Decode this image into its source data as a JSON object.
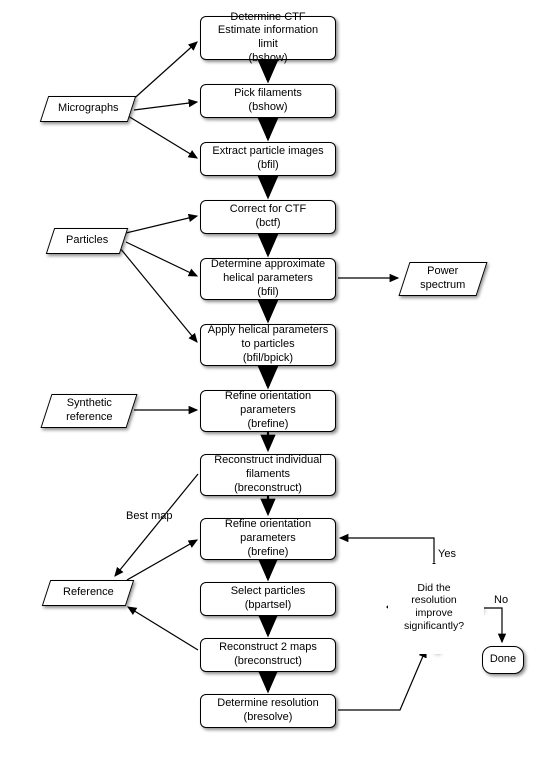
{
  "chart_data": {
    "type": "diagram",
    "title": "",
    "nodes": [
      {
        "id": "n1",
        "type": "process",
        "label": "Determine CTF\nEstimate information limit\n(bshow)"
      },
      {
        "id": "n2",
        "type": "process",
        "label": "Pick filaments\n(bshow)"
      },
      {
        "id": "n3",
        "type": "process",
        "label": "Extract particle images\n(bfil)"
      },
      {
        "id": "n4",
        "type": "process",
        "label": "Correct for CTF\n(bctf)"
      },
      {
        "id": "n5",
        "type": "process",
        "label": "Determine approximate\nhelical parameters\n(bfil)"
      },
      {
        "id": "n6",
        "type": "process",
        "label": "Apply helical parameters\nto particles\n(bfil/bpick)"
      },
      {
        "id": "n7",
        "type": "process",
        "label": "Refine orientation\nparameters\n(brefine)"
      },
      {
        "id": "n8",
        "type": "process",
        "label": "Reconstruct individual\nfilaments\n(breconstruct)"
      },
      {
        "id": "n9",
        "type": "process",
        "label": "Refine orientation\nparameters\n(brefine)"
      },
      {
        "id": "n10",
        "type": "process",
        "label": "Select particles\n(bpartsel)"
      },
      {
        "id": "n11",
        "type": "process",
        "label": "Reconstruct 2 maps\n(breconstruct)"
      },
      {
        "id": "n12",
        "type": "process",
        "label": "Determine resolution\n(bresolve)"
      },
      {
        "id": "io1",
        "type": "io",
        "label": "Micrographs"
      },
      {
        "id": "io2",
        "type": "io",
        "label": "Particles"
      },
      {
        "id": "io3",
        "type": "io",
        "label": "Power\nspectrum"
      },
      {
        "id": "io4",
        "type": "io",
        "label": "Synthetic\nreference"
      },
      {
        "id": "io5",
        "type": "io",
        "label": "Reference"
      },
      {
        "id": "d1",
        "type": "decision",
        "label": "Did the\nresolution\nimprove\nsignificantly?"
      },
      {
        "id": "t1",
        "type": "terminal",
        "label": "Done"
      }
    ],
    "edges": [
      {
        "from": "n1",
        "to": "n2"
      },
      {
        "from": "n2",
        "to": "n3"
      },
      {
        "from": "n3",
        "to": "n4"
      },
      {
        "from": "n4",
        "to": "n5"
      },
      {
        "from": "n5",
        "to": "n6"
      },
      {
        "from": "n6",
        "to": "n7"
      },
      {
        "from": "n7",
        "to": "n8"
      },
      {
        "from": "n8",
        "to": "n9"
      },
      {
        "from": "n9",
        "to": "n10"
      },
      {
        "from": "n10",
        "to": "n11"
      },
      {
        "from": "n11",
        "to": "n12"
      },
      {
        "from": "io1",
        "to": "n1"
      },
      {
        "from": "io1",
        "to": "n2"
      },
      {
        "from": "io1",
        "to": "n3"
      },
      {
        "from": "io2",
        "to": "n4"
      },
      {
        "from": "io2",
        "to": "n5"
      },
      {
        "from": "io2",
        "to": "n6"
      },
      {
        "from": "io4",
        "to": "n7"
      },
      {
        "from": "n5",
        "to": "io3"
      },
      {
        "from": "n8",
        "to": "io5",
        "label": "Best map"
      },
      {
        "from": "io5",
        "to": "n9"
      },
      {
        "from": "n11",
        "to": "io5"
      },
      {
        "from": "n12",
        "to": "d1"
      },
      {
        "from": "d1",
        "to": "n9",
        "label": "Yes"
      },
      {
        "from": "d1",
        "to": "t1",
        "label": "No"
      }
    ]
  },
  "labels": {
    "best_map": "Best map",
    "yes": "Yes",
    "no": "No"
  }
}
